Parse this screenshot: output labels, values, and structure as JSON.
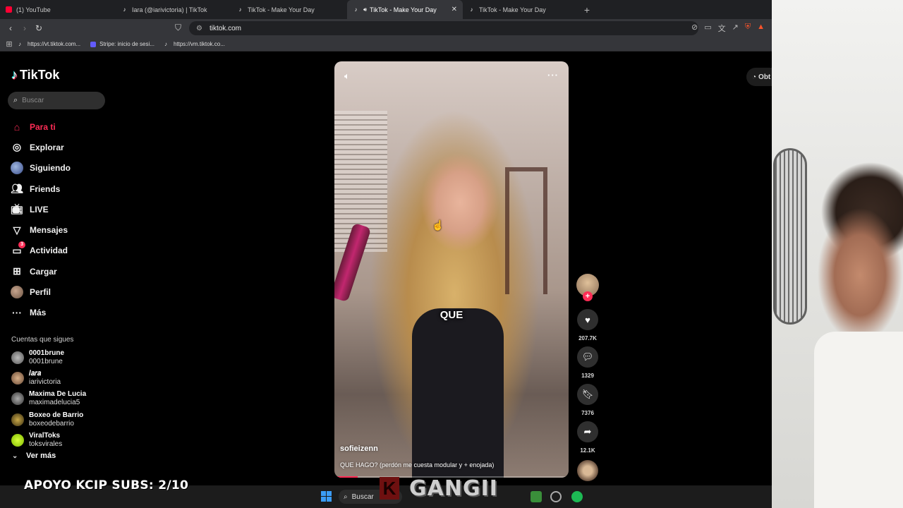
{
  "browser": {
    "tabs": [
      {
        "title": "(1) YouTube",
        "favicon": "youtube-icon",
        "active": false
      },
      {
        "title": "Iara (@iarivictoria) | TikTok",
        "favicon": "tiktok-icon",
        "active": false
      },
      {
        "title": "TikTok - Make Your Day",
        "favicon": "tiktok-icon",
        "active": false
      },
      {
        "title": "TikTok - Make Your Day",
        "favicon": "tiktok-icon",
        "active": true
      },
      {
        "title": "TikTok - Make Your Day",
        "favicon": "tiktok-icon",
        "active": false
      }
    ],
    "new_tab": "+",
    "close_glyph": "✕",
    "url": "tiktok.com",
    "bookmarks": [
      {
        "label": "https://vt.tiktok.com...",
        "icon": "tiktok-icon"
      },
      {
        "label": "Stripe: inicio de sesi...",
        "icon": "stripe-icon"
      },
      {
        "label": "https://vm.tiktok.co...",
        "icon": "tiktok-icon"
      }
    ]
  },
  "tiktok": {
    "logo_text": "TikTok",
    "search_placeholder": "Buscar",
    "nav": [
      {
        "label": "Para ti",
        "icon": "home-icon",
        "active": true
      },
      {
        "label": "Explorar",
        "icon": "compass-icon"
      },
      {
        "label": "Siguiendo",
        "icon": "following-avatar-icon"
      },
      {
        "label": "Friends",
        "icon": "friends-icon"
      },
      {
        "label": "LIVE",
        "icon": "live-icon"
      },
      {
        "label": "Mensajes",
        "icon": "messages-icon"
      },
      {
        "label": "Actividad",
        "icon": "activity-icon",
        "badge": "3"
      },
      {
        "label": "Cargar",
        "icon": "upload-icon"
      },
      {
        "label": "Perfil",
        "icon": "profile-avatar-icon"
      },
      {
        "label": "Más",
        "icon": "more-icon"
      }
    ],
    "following_title": "Cuentas que sigues",
    "following": [
      {
        "name": "0001brune",
        "handle": "0001brune"
      },
      {
        "name": "𝐼𝑎𝑟𝑎",
        "handle": "iarivictoria"
      },
      {
        "name": "Maxima De Lucia",
        "handle": "maximadelucia5"
      },
      {
        "name": "Boxeo de Barrio",
        "handle": "boxeodebarrio"
      },
      {
        "name": "ViralToks",
        "handle": "toksvirales"
      }
    ],
    "see_more": "Ver más",
    "get_app": "Obt",
    "video": {
      "caption_word": "QUE",
      "author": "sofieizenn",
      "description": "QUE HAGO? (perdón me cuesta modular y + enojada)",
      "progress": 0.1
    },
    "actions": {
      "likes": "207.7K",
      "comments": "1329",
      "saves": "7376",
      "shares": "12.1K"
    }
  },
  "overlay": {
    "support_text": "APOYO KCIP SUBS: 2/10",
    "logo_letter": "K",
    "logo_text": "GANGII"
  },
  "taskbar": {
    "search_label": "Buscar"
  },
  "colors": {
    "accent": "#fe2c55",
    "page_bg": "#000000",
    "chrome_bg": "#35363a"
  }
}
